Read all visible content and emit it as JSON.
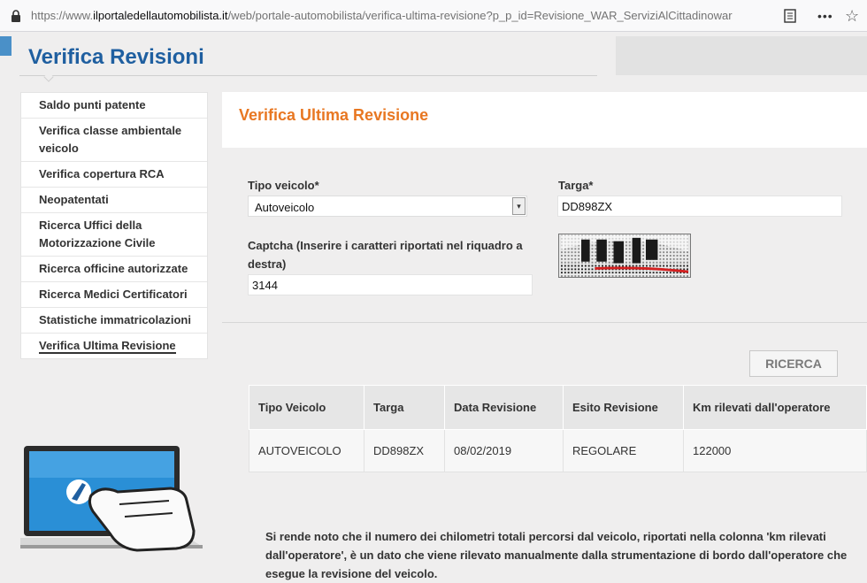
{
  "browser": {
    "url_prefix": "https://www.",
    "url_domain": "ilportaledellautomobilista.it",
    "url_rest": "/web/portale-automobilista/verifica-ultima-revisione?p_p_id=Revisione_WAR_ServiziAlCittadinowar",
    "more_label": "•••"
  },
  "page": {
    "title": "Verifica Revisioni"
  },
  "sidebar": {
    "items": [
      {
        "label": "Saldo punti patente"
      },
      {
        "label": "Verifica classe ambientale veicolo"
      },
      {
        "label": "Verifica copertura RCA"
      },
      {
        "label": "Neopatentati"
      },
      {
        "label": "Ricerca Uffici della Motorizzazione Civile"
      },
      {
        "label": "Ricerca officine autorizzate"
      },
      {
        "label": "Ricerca Medici Certificatori"
      },
      {
        "label": "Statistiche immatricolazioni"
      },
      {
        "label": "Verifica Ultima Revisione"
      }
    ]
  },
  "main": {
    "title": "Verifica Ultima Revisione",
    "form": {
      "tipo_label": "Tipo veicolo*",
      "tipo_value": "Autoveicolo",
      "targa_label": "Targa*",
      "targa_value": "DD898ZX",
      "captcha_label": "Captcha (Inserire i caratteri riportati nel riquadro a destra)",
      "captcha_value": "3144"
    },
    "search_button": "RICERCA",
    "table": {
      "headers": [
        "Tipo Veicolo",
        "Targa",
        "Data Revisione",
        "Esito Revisione",
        "Km rilevati dall'operatore"
      ],
      "rows": [
        [
          "AUTOVEICOLO",
          "DD898ZX",
          "08/02/2019",
          "REGOLARE",
          "122000"
        ]
      ]
    },
    "note": "Si rende noto che il numero dei chilometri totali percorsi dal veicolo, riportati nella colonna 'km rilevati dall'operatore', è un dato che viene rilevato manualmente dalla strumentazione di bordo dall'operatore che esegue la revisione del veicolo."
  },
  "colors": {
    "title_blue": "#1f5fa0",
    "accent_orange": "#e87722"
  }
}
